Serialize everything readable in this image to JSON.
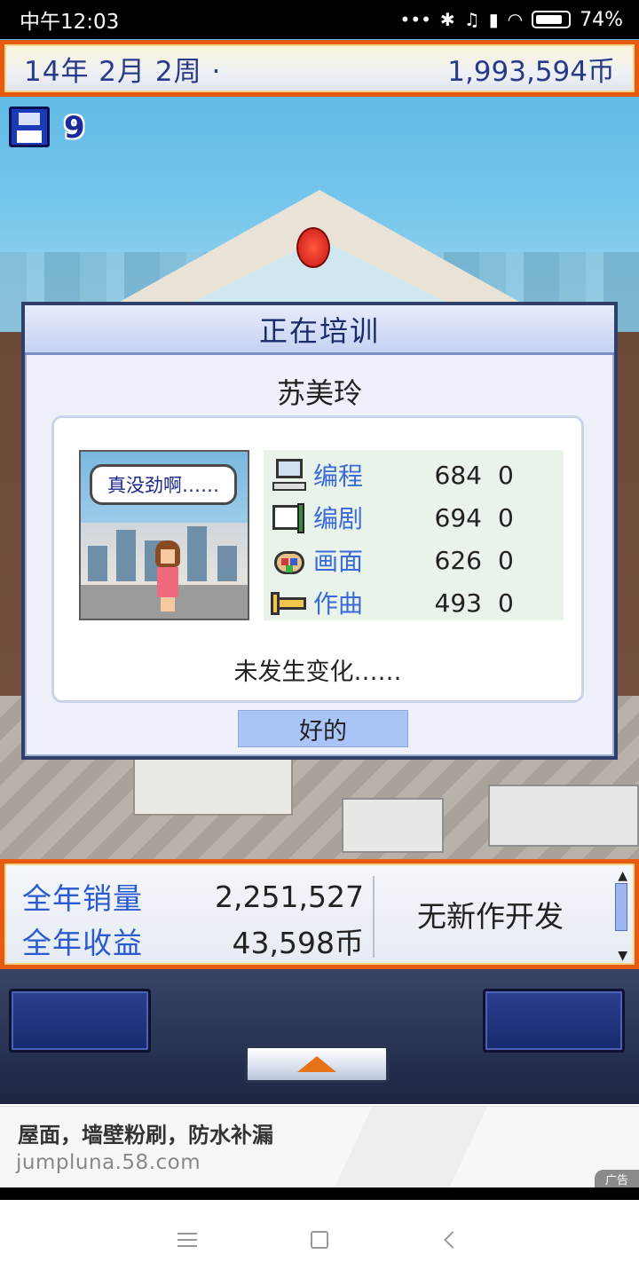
{
  "status_bar": {
    "time": "中午12:03",
    "battery": "74%",
    "icons": [
      "more-dots-icon",
      "bluetooth-icon",
      "mute-alarm-icon",
      "signal-icon",
      "wifi-icon",
      "battery-icon"
    ]
  },
  "top_bar": {
    "date": "14年 2月 2周 ·",
    "money": "1,993,594币"
  },
  "save": {
    "count": "9",
    "icon": "floppy-disk-icon"
  },
  "dialog": {
    "title": "正在培训",
    "employee_name": "苏美玲",
    "speech_bubble": "真没劲啊……",
    "stats": [
      {
        "icon": "computer-icon",
        "label": "编程",
        "value": "684",
        "delta": "0"
      },
      {
        "icon": "script-book-icon",
        "label": "编剧",
        "value": "694",
        "delta": "0"
      },
      {
        "icon": "paint-palette-icon",
        "label": "画面",
        "value": "626",
        "delta": "0"
      },
      {
        "icon": "trumpet-icon",
        "label": "作曲",
        "value": "493",
        "delta": "0"
      }
    ],
    "result": "未发生变化……",
    "ok_label": "好的"
  },
  "info_bar": {
    "annual_sales_label": "全年销量",
    "annual_sales_value": "2,251,527",
    "annual_revenue_label": "全年收益",
    "annual_revenue_value": "43,598币",
    "news": "无新作开发"
  },
  "ad": {
    "title": "屋面，墙壁粉刷，防水补漏",
    "url": "jumpluna.58.com",
    "tag": "广告"
  },
  "colors": {
    "frame_orange": "#e85a10",
    "title_blue": "#2a3a8a",
    "label_blue": "#3a6ad8",
    "ok_button": "#a9c4f7"
  }
}
